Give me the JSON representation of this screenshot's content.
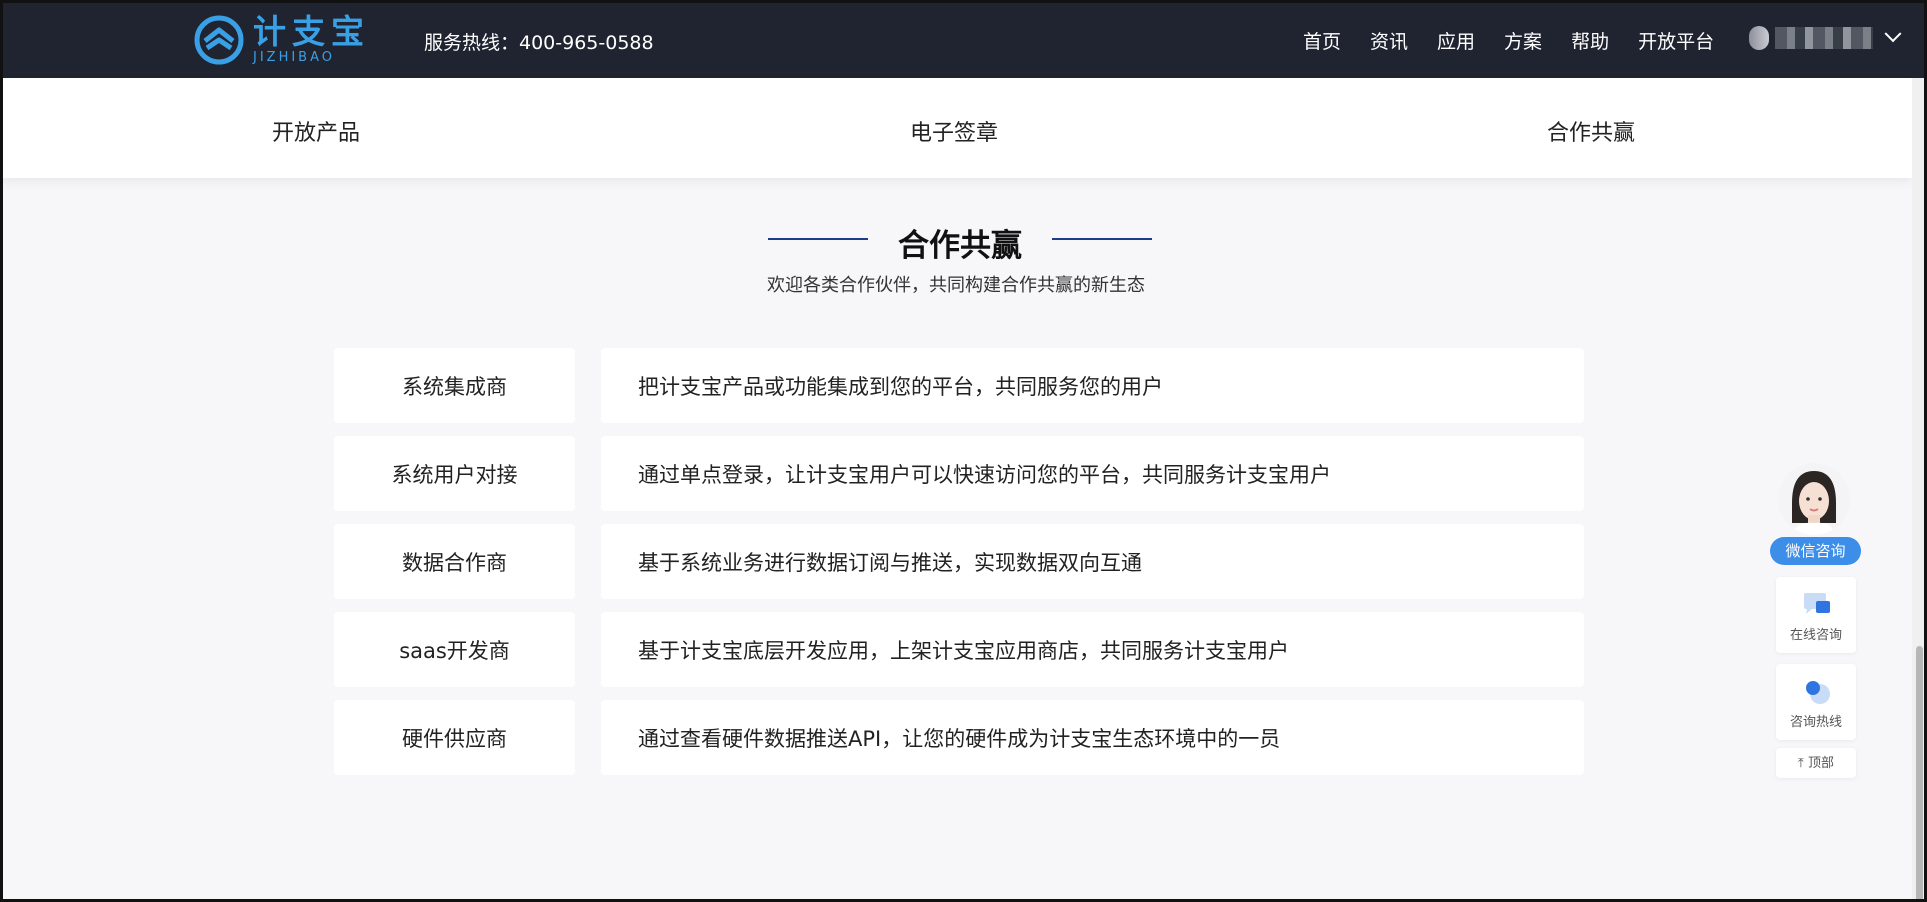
{
  "header": {
    "logo_cn": "计支宝",
    "logo_en": "JIZHIBAO",
    "hotline": "服务热线：400-965-0588",
    "nav": [
      "首页",
      "资讯",
      "应用",
      "方案",
      "帮助",
      "开放平台"
    ]
  },
  "tabs": [
    "开放产品",
    "电子签章",
    "合作共赢"
  ],
  "section": {
    "title": "合作共赢",
    "subtitle": "欢迎各类合作伙伴，共同构建合作共赢的新生态",
    "rows": [
      {
        "label": "系统集成商",
        "desc": "把计支宝产品或功能集成到您的平台，共同服务您的用户"
      },
      {
        "label": "系统用户对接",
        "desc": "通过单点登录，让计支宝用户可以快速访问您的平台，共同服务计支宝用户"
      },
      {
        "label": "数据合作商",
        "desc": "基于系统业务进行数据订阅与推送，实现数据双向互通"
      },
      {
        "label": "saas开发商",
        "desc": "基于计支宝底层开发应用，上架计支宝应用商店，共同服务计支宝用户"
      },
      {
        "label": "硬件供应商",
        "desc": "通过查看硬件数据推送API，让您的硬件成为计支宝生态环境中的一员"
      }
    ]
  },
  "float": {
    "wechat": "微信咨询",
    "online": "在线咨询",
    "hotline": "咨询热线",
    "top": "顶部"
  },
  "colors": {
    "header_bg": "#1f2430",
    "brand": "#3aa0e6",
    "accent": "#3d8ee8",
    "title_line": "#1c3c8c"
  }
}
